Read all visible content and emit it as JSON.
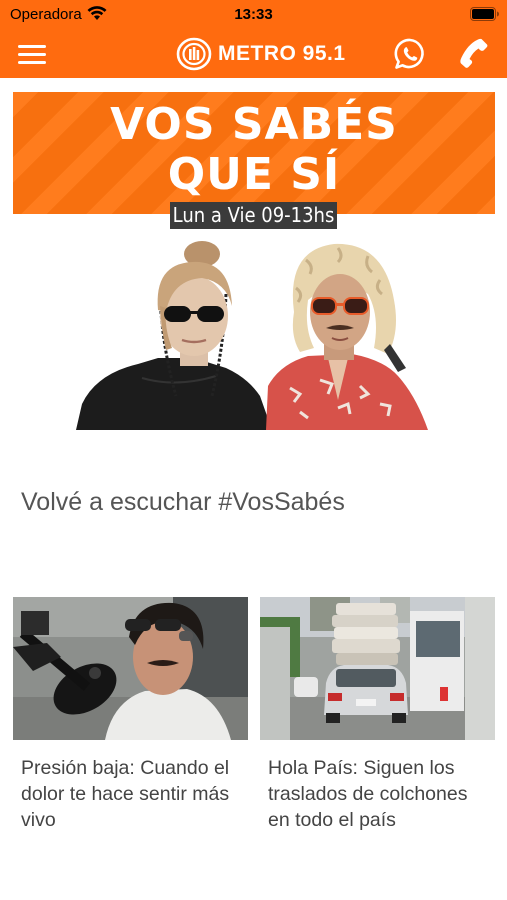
{
  "status_bar": {
    "carrier": "Operadora",
    "time": "13:33"
  },
  "nav": {
    "brand_name": "METRO 95.1",
    "icons": [
      "menu-icon",
      "whatsapp-icon",
      "phone-icon"
    ]
  },
  "hero": {
    "title_line1": "VOS SABÉS",
    "title_line2": "QUE SÍ",
    "schedule": "Lun a Vie 09-13hs"
  },
  "section": {
    "title": "Volvé a escuchar #VosSabés"
  },
  "cards": [
    {
      "title": "Presión baja: Cuando el dolor te hace sentir más vivo"
    },
    {
      "title": "Hola País: Siguen los traslados de colchones en todo el país"
    }
  ],
  "colors": {
    "brand_orange": "#ff6b0f",
    "banner_orange": "#ff740f",
    "text_gray": "#555555"
  }
}
